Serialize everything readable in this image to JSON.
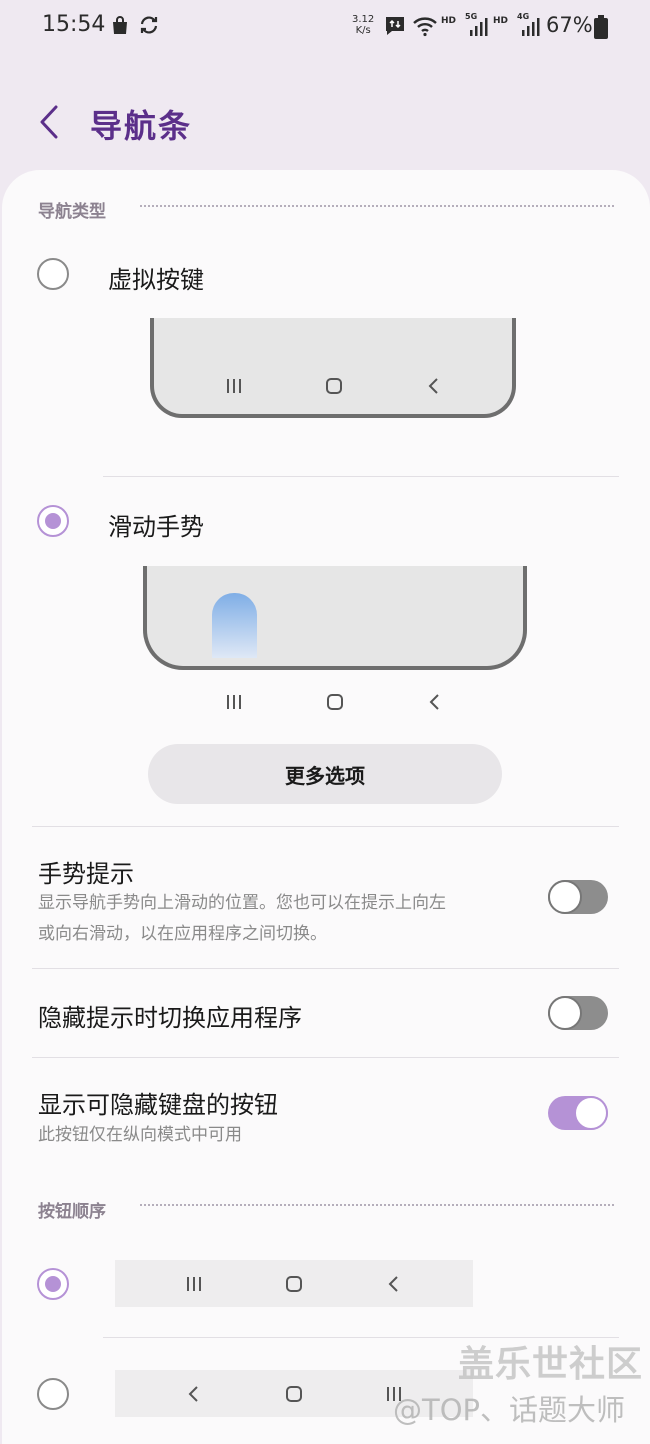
{
  "status_bar": {
    "time": "15:54",
    "net_speed_value": "3.12",
    "net_speed_unit": "K/s",
    "hd1": "HD",
    "net1": "5G",
    "hd2": "HD",
    "net2": "4G",
    "battery": "67%",
    "icons": [
      "shopping-bag-icon",
      "sync-icon",
      "message-upload-icon",
      "wifi-icon",
      "signal-icon",
      "signal-icon",
      "battery-icon"
    ]
  },
  "header": {
    "title": "导航条",
    "back_icon": "chevron-left-icon"
  },
  "nav_type": {
    "section_title": "导航类型",
    "options": [
      {
        "label": "虚拟按键",
        "selected": false
      },
      {
        "label": "滑动手势",
        "selected": true
      }
    ],
    "more_button": "更多选项"
  },
  "settings": [
    {
      "title": "手势提示",
      "desc_line1": "显示导航手势向上滑动的位置。您也可以在提示上向左",
      "desc_line2": "或向右滑动，以在应用程序之间切换。",
      "enabled": false
    },
    {
      "title": "隐藏提示时切换应用程序",
      "enabled": false
    },
    {
      "title": "显示可隐藏键盘的按钮",
      "desc": "此按钮仅在纵向模式中可用",
      "enabled": true
    }
  ],
  "button_order": {
    "section_title": "按钮顺序",
    "options": [
      {
        "order": [
          "recents-icon",
          "home-icon",
          "back-icon"
        ],
        "selected": true
      },
      {
        "order": [
          "back-icon",
          "home-icon",
          "recents-icon"
        ],
        "selected": false
      }
    ]
  },
  "watermark": {
    "line1": "盖乐世社区",
    "line2": "@TOP、话题大师"
  },
  "colors": {
    "accent": "#b592d6",
    "title": "#5b2f8a",
    "background": "#efe9f1",
    "card": "#fbfafb"
  }
}
